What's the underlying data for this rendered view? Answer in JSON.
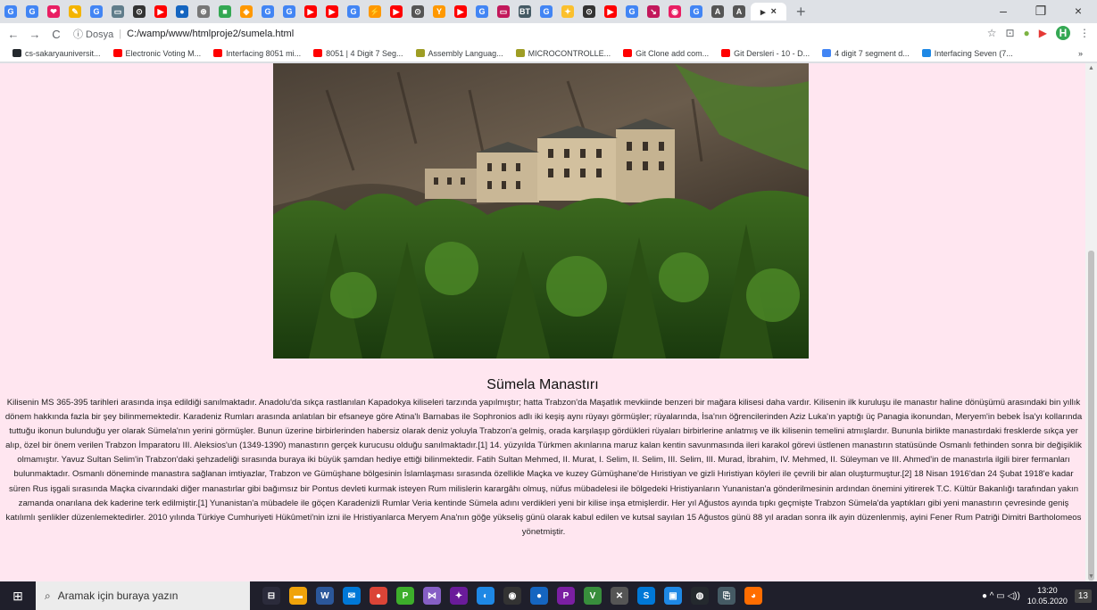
{
  "browser": {
    "tabs": [
      {
        "icon": "G",
        "color": "#4285f4"
      },
      {
        "icon": "G",
        "color": "#4285f4"
      },
      {
        "icon": "❤",
        "color": "#e91e63"
      },
      {
        "icon": "✎",
        "color": "#f4b400"
      },
      {
        "icon": "G",
        "color": "#4285f4"
      },
      {
        "icon": "▭",
        "color": "#607d8b"
      },
      {
        "icon": "⊙",
        "color": "#333333"
      },
      {
        "icon": "▶",
        "color": "#ff0000"
      },
      {
        "icon": "●",
        "color": "#1565c0"
      },
      {
        "icon": "⊛",
        "color": "#777777"
      },
      {
        "icon": "■",
        "color": "#34a853"
      },
      {
        "icon": "◈",
        "color": "#ff9800"
      },
      {
        "icon": "G",
        "color": "#4285f4"
      },
      {
        "icon": "G",
        "color": "#4285f4"
      },
      {
        "icon": "▶",
        "color": "#ff0000"
      },
      {
        "icon": "▶",
        "color": "#ff0000"
      },
      {
        "icon": "G",
        "color": "#4285f4"
      },
      {
        "icon": "⚡",
        "color": "#ff9800"
      },
      {
        "icon": "▶",
        "color": "#ff0000"
      },
      {
        "icon": "⊙",
        "color": "#555555"
      },
      {
        "icon": "Y",
        "color": "#ff9800"
      },
      {
        "icon": "▶",
        "color": "#ff0000"
      },
      {
        "icon": "G",
        "color": "#4285f4"
      },
      {
        "icon": "▭",
        "color": "#c2185b"
      },
      {
        "icon": "BT",
        "color": "#455a64"
      },
      {
        "icon": "G",
        "color": "#4285f4"
      },
      {
        "icon": "✦",
        "color": "#fbc02d"
      },
      {
        "icon": "⊙",
        "color": "#333333"
      },
      {
        "icon": "▶",
        "color": "#ff0000"
      },
      {
        "icon": "G",
        "color": "#4285f4"
      },
      {
        "icon": "↘",
        "color": "#c2185b"
      },
      {
        "icon": "◉",
        "color": "#e91e63"
      },
      {
        "icon": "G",
        "color": "#4285f4"
      },
      {
        "icon": "A",
        "color": "#555555"
      },
      {
        "icon": "A",
        "color": "#555555"
      }
    ],
    "active_tab": {
      "icon": "▸",
      "close": "×"
    },
    "new_tab": "+",
    "window_controls": {
      "minimize": "–",
      "maximize": "❐",
      "close": "×"
    },
    "nav": {
      "back": "←",
      "forward": "→",
      "reload": "C"
    },
    "address": {
      "security": "ⓘ Dosya",
      "separator": "|",
      "url": "C:/wamp/www/htmlproje2/sumela.html"
    },
    "toolbar_icons": {
      "star": "☆",
      "ext1": "⊡",
      "ext2": "●",
      "ext3": "▶",
      "profile": "H",
      "menu": "⋮"
    },
    "bookmarks": [
      {
        "label": "cs-sakaryauniversit...",
        "color": "#24292e"
      },
      {
        "label": "Electronic Voting M...",
        "color": "#ff0000"
      },
      {
        "label": "Interfacing 8051 mi...",
        "color": "#ff0000"
      },
      {
        "label": "8051 | 4 Digit 7 Seg...",
        "color": "#ff0000"
      },
      {
        "label": "Assembly Languag...",
        "color": "#9e9d24"
      },
      {
        "label": "MICROCONTROLLE...",
        "color": "#9e9d24"
      },
      {
        "label": "Git Clone add com...",
        "color": "#ff0000"
      },
      {
        "label": "Git Dersleri - 10 - D...",
        "color": "#ff0000"
      },
      {
        "label": "4 digit 7 segment d...",
        "color": "#4285f4"
      },
      {
        "label": "Interfacing Seven (7...",
        "color": "#1e88e5"
      }
    ],
    "bookmarks_more": "»"
  },
  "page": {
    "background": "#ffe6f0",
    "title": "Sümela Manastırı",
    "paragraph": "Kilisenin MS 365-395 tarihleri arasında inşa edildiği sanılmaktadır. Anadolu'da sıkça rastlanılan Kapadokya kiliseleri tarzında yapılmıştır; hatta Trabzon'da Maşatlık mevkiinde benzeri bir mağara kilisesi daha vardır. Kilisenin ilk kuruluşu ile manastır haline dönüşümü arasındaki bin yıllık dönem hakkında fazla bir şey bilinmemektedir. Karadeniz Rumları arasında anlatılan bir efsaneye göre Atina'lı Barnabas ile Sophronios adlı iki keşiş aynı rüyayı görmüşler; rüyalarında, İsa'nın öğrencilerinden Aziz Luka'ın yaptığı üç Panagia ikonundan, Meryem'in bebek İsa'yı kollarında tuttuğu ikonun bulunduğu yer olarak Sümela'nın yerini görmüşler. Bunun üzerine birbirlerinden habersiz olarak deniz yoluyla Trabzon'a gelmiş, orada karşılaşıp gördükleri rüyaları birbirlerine anlatmış ve ilk kilisenin temelini atmışlardır. Bununla birlikte manastırdaki fresklerde sıkça yer alıp, özel bir önem verilen Trabzon İmparatoru III. Aleksios'un (1349-1390) manastırın gerçek kurucusu olduğu sanılmaktadır.[1] 14. yüzyılda Türkmen akınlarına maruz kalan kentin savunmasında ileri karakol görevi üstlenen manastırın statüsünde Osmanlı fethinden sonra bir değişiklik olmamıştır. Yavuz Sultan Selim'in Trabzon'daki şehzadeliği sırasında buraya iki büyük şamdan hediye ettiği bilinmektedir. Fatih Sultan Mehmed, II. Murat, I. Selim, II. Selim, III. Selim, III. Murad, İbrahim, IV. Mehmed, II. Süleyman ve III. Ahmed'in de manastırla ilgili birer fermanları bulunmaktadır. Osmanlı döneminde manastıra sağlanan imtiyazlar, Trabzon ve Gümüşhane bölgesinin İslamlaşması sırasında özellikle Maçka ve kuzey Gümüşhane'de Hıristiyan ve gizli Hıristiyan köyleri ile çevrili bir alan oluşturmuştur.[2] 18 Nisan 1916'dan 24 Şubat 1918'e kadar süren Rus işgali sırasında Maçka civarındaki diğer manastırlar gibi bağımsız bir Pontus devleti kurmak isteyen Rum milislerin karargâhı olmuş, nüfus mübadelesi ile bölgedeki Hristiyanların Yunanistan'a gönderilmesinin ardından önemini yitirerek T.C. Kültür Bakanlığı tarafından yakın zamanda onarılana dek kaderine terk edilmiştir.[1] Yunanistan'a mübadele ile göçen Karadenizli Rumlar Veria kentinde Sümela adını verdikleri yeni bir kilise inşa etmişlerdir. Her yıl Ağustos ayında tıpkı geçmişte Trabzon Sümela'da yaptıkları gibi yeni manastırın çevresinde geniş katılımlı şenlikler düzenlemektedirler. 2010 yılında Türkiye Cumhuriyeti Hükûmeti'nin izni ile Hristiyanlarca Meryem Ana'nın göğe yükseliş günü olarak kabul edilen ve kutsal sayılan 15 Ağustos günü 88 yıl aradan sonra ilk ayin düzenlenmiş, ayini Fener Rum Patriği Dimitri Bartholomeos yönetmiştir."
  },
  "taskbar": {
    "start": "⊞",
    "search_icon": "⌕",
    "search_placeholder": "Aramak için buraya yazın",
    "apps": [
      {
        "icon": "⊟",
        "color": "#2b2b3b"
      },
      {
        "icon": "▬",
        "color": "#f0a30a"
      },
      {
        "icon": "W",
        "color": "#2b579a"
      },
      {
        "icon": "✉",
        "color": "#0078d7"
      },
      {
        "icon": "●",
        "color": "#db4437"
      },
      {
        "icon": "P",
        "color": "#3dae2b"
      },
      {
        "icon": "⋈",
        "color": "#865fc5"
      },
      {
        "icon": "✦",
        "color": "#6a1b9a"
      },
      {
        "icon": "◐",
        "color": "#1e88e5"
      },
      {
        "icon": "◉",
        "color": "#333333"
      },
      {
        "icon": "●",
        "color": "#1565c0"
      },
      {
        "icon": "P",
        "color": "#7b1fa2"
      },
      {
        "icon": "V",
        "color": "#388e3c"
      },
      {
        "icon": "✕",
        "color": "#555555"
      },
      {
        "icon": "S",
        "color": "#0078d7"
      },
      {
        "icon": "▣",
        "color": "#1e88e5"
      },
      {
        "icon": "◍",
        "color": "#24292e"
      },
      {
        "icon": "⎘",
        "color": "#455a64"
      },
      {
        "icon": "◕",
        "color": "#ff6d00"
      }
    ],
    "tray": {
      "icons": "● ^ ▭ ◁))",
      "time": "13:20",
      "date": "10.05.2020",
      "notifications": "13"
    }
  }
}
